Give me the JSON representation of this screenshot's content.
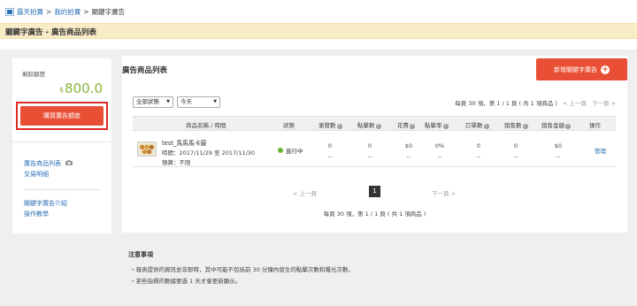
{
  "breadcrumb": {
    "items": [
      "露天拍賣",
      "我的拍賣"
    ],
    "separator": ">",
    "current": "關鍵字廣告"
  },
  "page_title": "關鍵字廣告 - 廣告商品列表",
  "sidebar": {
    "quota_label": "剩餘額度",
    "currency": "$",
    "quota_value": "800.0",
    "buy_button": "購買廣告額度",
    "links_group1": [
      "廣告商品列表",
      "交易明細"
    ],
    "links_group2": [
      "關鍵字廣告介紹",
      "操作教學"
    ]
  },
  "main": {
    "title": "廣告商品列表",
    "add_button": "新增關鍵字廣告",
    "filter_status": "全部狀態",
    "filter_date": "今天",
    "pager_top": {
      "summary": "每頁 30 項，第 1 / 1 頁 ( 共 1 項商品 )",
      "prev": "< 上一頁",
      "next": "下一頁 >"
    },
    "columns": [
      "商品名稱 / 時間",
      "狀態",
      "瀏覽數",
      "點擊數",
      "花費",
      "點擊率",
      "訂單數",
      "銷售數",
      "銷售金額",
      "操作"
    ],
    "rows": [
      {
        "name": "test_馬馬馬卡龍",
        "time": "時間：2017/11/29 至 2017/11/30",
        "budget": "預算：不限",
        "status": "進行中",
        "views": "0",
        "clicks": "0",
        "cost": "$0",
        "ctr": "0%",
        "orders": "0",
        "sales": "0",
        "sales_amount": "$0",
        "dash": "--",
        "action": "管理"
      }
    ],
    "pager_bottom": {
      "prev": "< 上一頁",
      "page": "1",
      "next": "下一頁 >",
      "summary": "每頁 30 項，第 1 / 1 頁 ( 共 1 項商品 )"
    }
  },
  "notes": {
    "title": "注意事項",
    "items": [
      "・報表提供的資訊並非即時，其中可能不包括前 30 分鐘內發生的點擊次數和曝光次數。",
      "・某些指標的數據要過 1 天才會更新顯示。"
    ]
  },
  "colors": {
    "accent_red": "#e94f34",
    "highlight_border": "#e02b25",
    "quota_green": "#8ab33c",
    "status_green": "#6ab531",
    "link_blue": "#2a6fb5",
    "title_band": "#f8ecc7"
  }
}
